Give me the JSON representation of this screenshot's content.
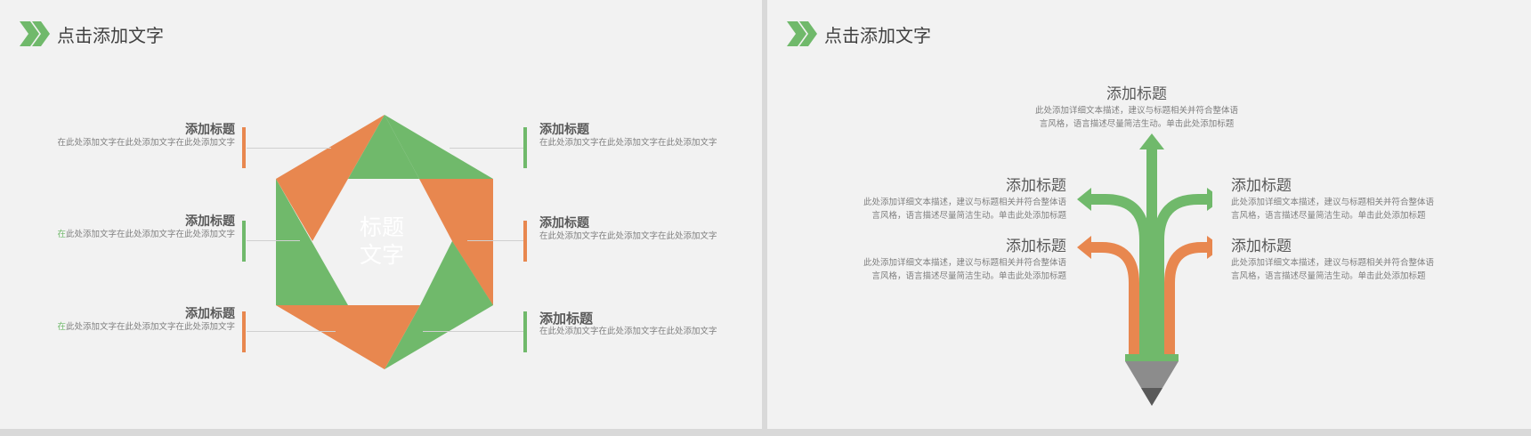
{
  "colors": {
    "green": "#70b96b",
    "orange": "#e8874f",
    "text_dark": "#595959",
    "text_light": "#7f7f7f",
    "background": "#f2f2f2"
  },
  "left_slide": {
    "header": {
      "icon": "double-chevron-icon",
      "title": "点击添加文字"
    },
    "center_text": {
      "line1": "标题",
      "line2": "文字"
    },
    "items_left": [
      {
        "title": "添加标题",
        "text": "在此处添加文字在此处添加文字在此处添加文字",
        "accent": "orange"
      },
      {
        "title": "添加标题",
        "first_char": "在",
        "text": "此处添加文字在此处添加文字在此处添加文字",
        "accent": "green"
      },
      {
        "title": "添加标题",
        "first_char": "在",
        "text": "此处添加文字在此处添加文字在此处添加文字",
        "accent": "orange"
      }
    ],
    "items_right": [
      {
        "title": "添加标题",
        "text": "在此处添加文字在此处添加文字在此处添加文字",
        "accent": "green"
      },
      {
        "title": "添加标题",
        "text": "在此处添加文字在此处添加文字在此处添加文字",
        "accent": "orange"
      },
      {
        "title": "添加标题",
        "text": "在此处添加文字在此处添加文字在此处添加文字",
        "accent": "green"
      }
    ]
  },
  "right_slide": {
    "header": {
      "icon": "double-chevron-icon",
      "title": "点击添加文字"
    },
    "pencil_icon": "pencil-arrows-icon",
    "top_item": {
      "title": "添加标题",
      "text": "此处添加详细文本描述，建议与标题相关并符合整体语言风格，语言描述尽量简洁生动。单击此处添加标题"
    },
    "left_items": [
      {
        "title": "添加标题",
        "text": "此处添加详细文本描述，建议与标题相关并符合整体语言风格，语言描述尽量简洁生动。单击此处添加标题"
      },
      {
        "title": "添加标题",
        "text": "此处添加详细文本描述，建议与标题相关并符合整体语言风格，语言描述尽量简洁生动。单击此处添加标题"
      }
    ],
    "right_items": [
      {
        "title": "添加标题",
        "text": "此处添加详细文本描述，建议与标题相关并符合整体语言风格，语言描述尽量简洁生动。单击此处添加标题"
      },
      {
        "title": "添加标题",
        "text": "此处添加详细文本描述，建议与标题相关并符合整体语言风格，语言描述尽量简洁生动。单击此处添加标题"
      }
    ]
  }
}
